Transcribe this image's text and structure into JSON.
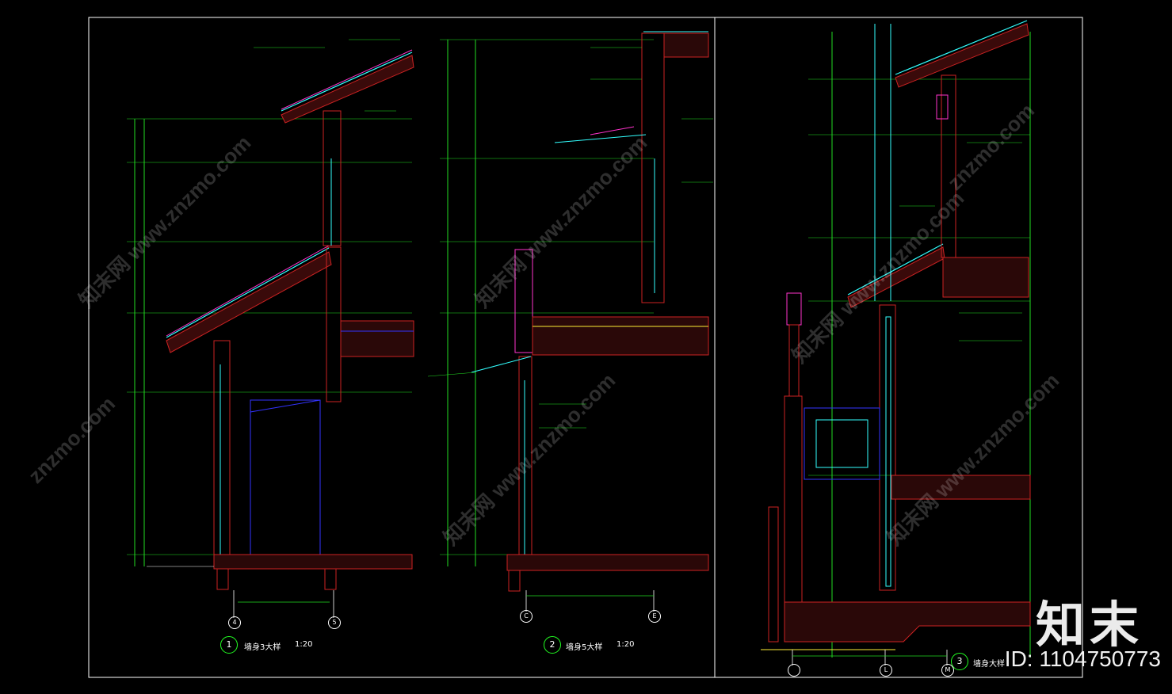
{
  "colors": {
    "background": "#000000",
    "frame": "#ffffff",
    "dim_green": "#22dd22",
    "concrete_red": "#cc2222",
    "accent_magenta": "#ff33cc",
    "glass_cyan": "#33ffff",
    "blue_line": "#3333ff",
    "yellow_line": "#ffee33"
  },
  "sections": [
    {
      "number": "1",
      "title": "墙身3大样",
      "scale": "1:20",
      "axes": [
        "4",
        "5"
      ]
    },
    {
      "number": "2",
      "title": "墙身5大样",
      "scale": "1:20",
      "axes": [
        "C",
        "E"
      ]
    },
    {
      "number": "3",
      "title": "墙身大样",
      "scale": "",
      "axes": [
        "",
        "L",
        "M"
      ]
    }
  ],
  "watermark": {
    "text": "知末网 www.znzmo.com",
    "short": "znzmo.com"
  },
  "brand": {
    "name": "知末",
    "id_label": "ID: 1104750773"
  }
}
